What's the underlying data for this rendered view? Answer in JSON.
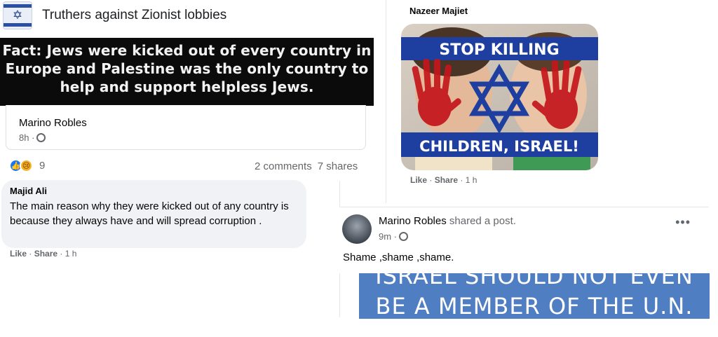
{
  "group": {
    "name": "Truthers against Zionist lobbies",
    "logo_icon": "israel-flag-logo"
  },
  "fact_post": {
    "banner_lines": [
      "Fact: Jews were kicked out of every country in",
      "Europe and Palestine was the only country to",
      "help and support helpless Jews."
    ],
    "author": "Marino Robles",
    "time": "8h ·",
    "reaction_count": "9",
    "comments": "2 comments",
    "shares": "7 shares"
  },
  "comment": {
    "author": "Majid Ali",
    "text": "The main reason why they were kicked out of any country is because they always have and will spread corruption .",
    "like": "Like",
    "sep1": " · ",
    "share": "Share",
    "sep2": " · ",
    "time": "1 h"
  },
  "photo_post": {
    "author": "Nazeer Majiet",
    "top_text": "STOP KILLING",
    "bottom_text": "CHILDREN, ISRAEL!",
    "like": "Like",
    "sep1": " · ",
    "share": "Share",
    "sep2": " · ",
    "time": "1 h"
  },
  "shared_post": {
    "author": "Marino Robles",
    "action": "shared a post.",
    "time": "9m ·",
    "text": "Shame ,shame ,shame.",
    "more_label": "•••",
    "banner_line1": "ISRAEL SHOULD NOT EVEN",
    "banner_line2": "BE A MEMBER OF THE U.N."
  },
  "colors": {
    "flag_blue": "#1f3fa0",
    "banner_black": "#0b0b0b",
    "un_blue": "#4f7ec3",
    "fb_blue": "#1877f2",
    "paint_red": "#c4161c",
    "meta_gray": "#65676b"
  }
}
